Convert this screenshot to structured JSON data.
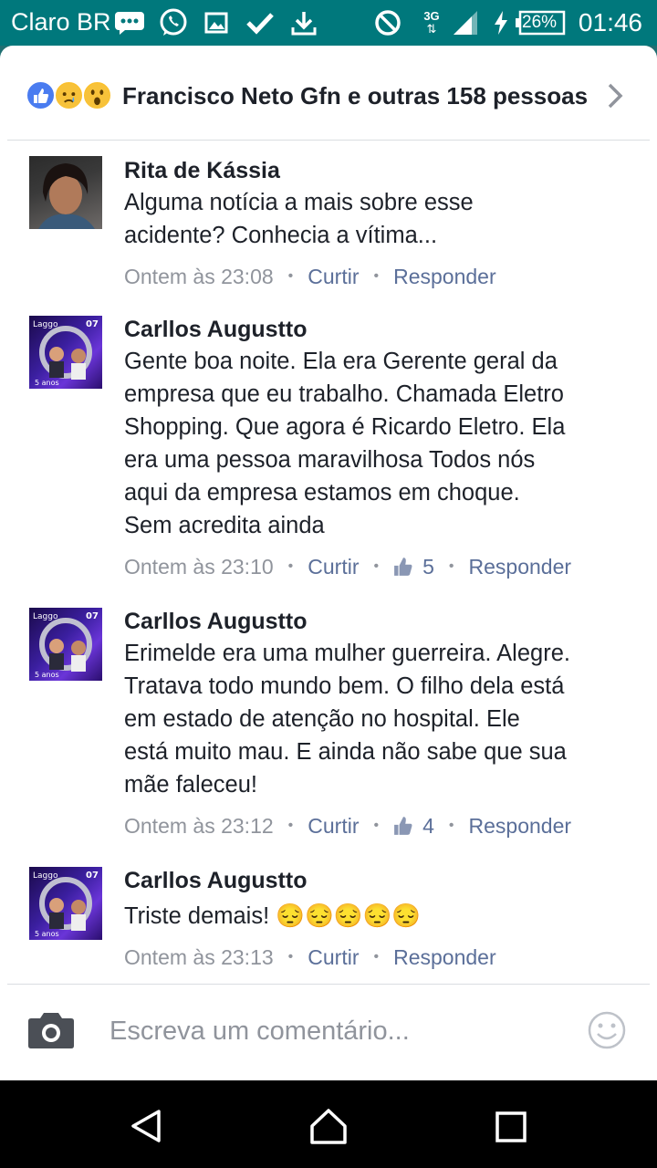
{
  "statusbar": {
    "carrier": "Claro BR",
    "network": "3G",
    "battery": "26%",
    "time": "01:46",
    "icons": [
      "message-icon",
      "whatsapp-icon",
      "gallery-icon",
      "check-icon",
      "download-icon",
      "do-not-disturb-icon",
      "network-3g-icon",
      "signal-icon",
      "charging-icon",
      "battery-icon"
    ]
  },
  "header": {
    "reactions": [
      "like",
      "sad",
      "wow"
    ],
    "text": "Francisco Neto Gfn e outras 158 pessoas"
  },
  "comments": [
    {
      "author": "Rita de Kássia",
      "lines": [
        "Alguma notícia a mais sobre esse",
        "acidente? Conhecia a vítima..."
      ],
      "time": "Ontem às 23:08",
      "like_label": "Curtir",
      "likes": "",
      "reply_label": "Responder"
    },
    {
      "author": "Carllos Augustto",
      "lines": [
        "Gente boa noite. Ela era Gerente geral da",
        "empresa que eu trabalho.  Chamada Eletro",
        "Shopping. Que agora é Ricardo Eletro. Ela",
        "era uma pessoa maravilhosa Todos nós",
        "aqui da empresa estamos em choque.",
        "Sem acredita ainda"
      ],
      "time": "Ontem às 23:10",
      "like_label": "Curtir",
      "likes": "5",
      "reply_label": "Responder"
    },
    {
      "author": "Carllos Augustto",
      "lines": [
        "Erimelde era uma mulher guerreira. Alegre.",
        "Tratava todo mundo bem. O filho dela está",
        "em estado de atenção no hospital. Ele",
        "está muito mau. E ainda não sabe que sua",
        "mãe faleceu!"
      ],
      "time": "Ontem às 23:12",
      "like_label": "Curtir",
      "likes": "4",
      "reply_label": "Responder"
    },
    {
      "author": "Carllos Augustto",
      "lines": [
        "Triste demais! 😔😔😔😔😔"
      ],
      "time": "Ontem às 23:13",
      "like_label": "Curtir",
      "likes": "",
      "reply_label": "Responder"
    }
  ],
  "composer": {
    "placeholder": "Escreva um comentário..."
  },
  "navbar": {
    "buttons": [
      "back-icon",
      "home-icon",
      "recents-icon"
    ]
  },
  "colors": {
    "statusbar": "#00787c",
    "text": "#1d2129",
    "meta": "#90949c",
    "action": "#5b6f99",
    "like": "#4a7cf0"
  }
}
